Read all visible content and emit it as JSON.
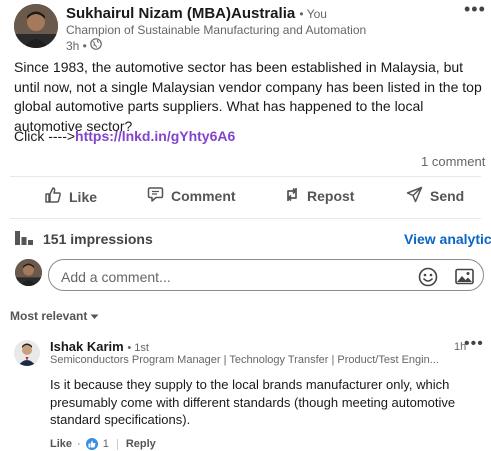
{
  "post": {
    "author_name": "Sukhairul Nizam (MBA)Australia",
    "author_you": "• You",
    "author_headline": "Champion of Sustainable Manufacturing and Automation",
    "time": "3h •",
    "body": "Since 1983, the automotive sector has been established in Malaysia, but until now, not a single Malaysian vendor company has been listed in the top global automotive parts suppliers. What has happened to the local automotive sector?",
    "link_prefix": "Click ---->",
    "link_text": "https://lnkd.in/gYhty6A6",
    "comment_count": "1 comment"
  },
  "actions": {
    "like": "Like",
    "comment": "Comment",
    "repost": "Repost",
    "send": "Send"
  },
  "analytics": {
    "impressions": "151 impressions",
    "view_analytics": "View analytics"
  },
  "composer": {
    "placeholder": "Add a comment..."
  },
  "sort": {
    "label": "Most relevant"
  },
  "comment": {
    "name": "Ishak Karim",
    "degree": "• 1st",
    "time": "1h",
    "headline": "Semiconductors Program Manager | Technology Transfer | Product/Test Engin...",
    "body": "Is it because they supply to the local brands manufacturer only, which presumably come with different standards (though meeting automotive standard specifications).",
    "like_label": "Like",
    "dot": "·",
    "reaction_count": "1",
    "reply_label": "Reply"
  },
  "colors": {
    "link": "#8344cc",
    "accent": "#0a66c2",
    "like_badge": "#378fe9"
  },
  "icons": {
    "post_more": "more-horizontal-icon",
    "globe": "globe-icon",
    "like": "thumbs-up-icon",
    "comment": "speech-bubble-icon",
    "repost": "repost-arrows-icon",
    "send": "paper-plane-icon",
    "impressions": "bar-chart-icon",
    "emoji": "smiley-icon",
    "image": "image-icon",
    "dropdown": "caret-down-icon"
  }
}
